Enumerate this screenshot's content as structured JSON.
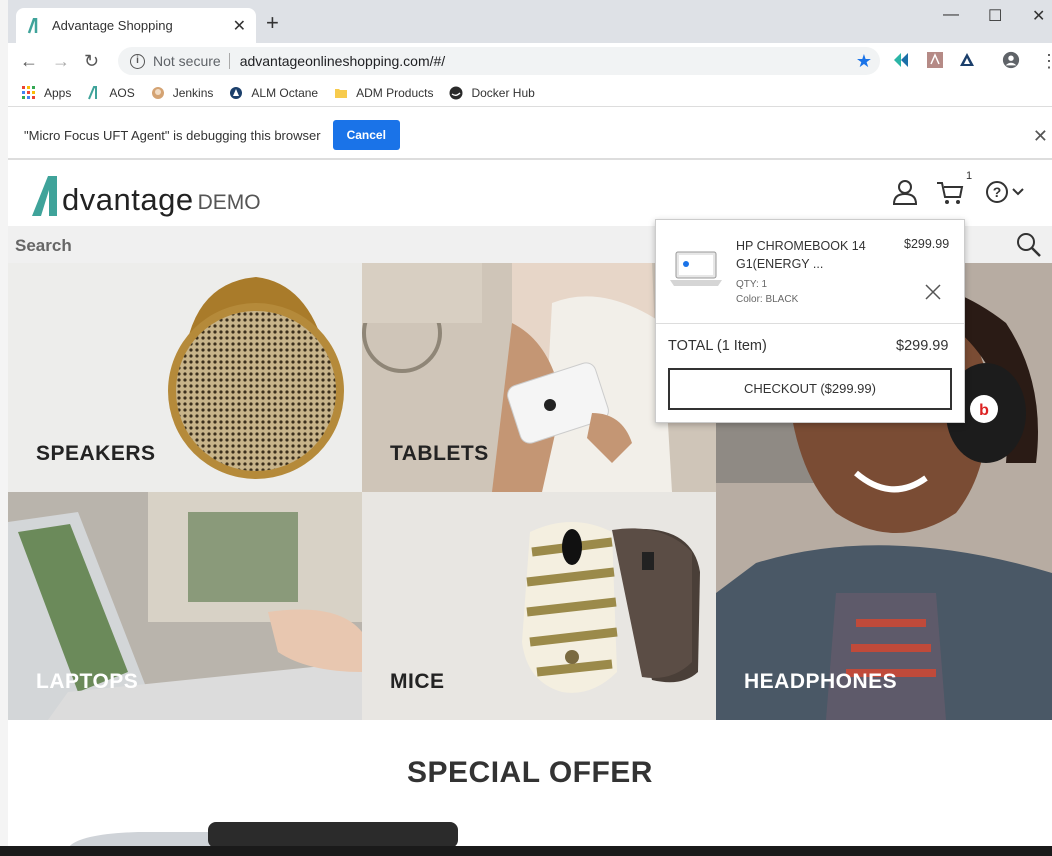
{
  "browser": {
    "tab_title": "Advantage Shopping",
    "tab_close": "✕",
    "new_tab": "+",
    "controls": {
      "minimize": "—",
      "maximize": "☐",
      "close": "✕"
    },
    "nav": {
      "back": "←",
      "forward": "→",
      "reload": "↻"
    },
    "security_label": "Not secure",
    "url": "advantageonlineshopping.com/#/",
    "bookmark_star": "★",
    "bookmarks": [
      {
        "label": "Apps",
        "icon": "apps-grid-icon"
      },
      {
        "label": "AOS",
        "icon": "aos-logo-icon"
      },
      {
        "label": "Jenkins",
        "icon": "jenkins-icon"
      },
      {
        "label": "ALM Octane",
        "icon": "octane-icon"
      },
      {
        "label": "ADM Products",
        "icon": "folder-icon"
      },
      {
        "label": "Docker Hub",
        "icon": "docker-icon"
      }
    ],
    "infobar": {
      "message": "\"Micro Focus UFT Agent\" is debugging this browser",
      "cancel": "Cancel",
      "close": "✕"
    }
  },
  "site": {
    "logo_word": "dvantage",
    "logo_demo": "DEMO",
    "cart_count": "1",
    "search_label": "Search",
    "categories": [
      {
        "label": "SPEAKERS"
      },
      {
        "label": "TABLETS"
      },
      {
        "label": "HEADPHONES"
      },
      {
        "label": "LAPTOPS"
      },
      {
        "label": "MICE"
      }
    ],
    "special_offer": "SPECIAL OFFER"
  },
  "cart_popup": {
    "item": {
      "name": "HP CHROMEBOOK 14 G1(ENERGY ...",
      "price": "$299.99",
      "qty": "QTY: 1",
      "color": "Color: BLACK"
    },
    "total_label": "TOTAL (1 Item)",
    "total_price": "$299.99",
    "checkout": "CHECKOUT ($299.99)"
  },
  "colors": {
    "accent": "#1a73e8",
    "logo_teal": "#3fa39a",
    "tab_bg": "#dee1e6"
  }
}
